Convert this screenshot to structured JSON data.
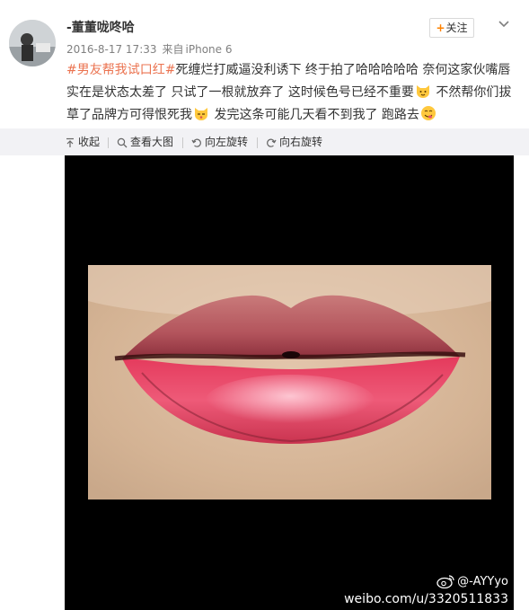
{
  "post": {
    "username": "-董董咙咚哈",
    "timestamp": "2016-8-17 17:33",
    "source_prefix": "来自",
    "source": "iPhone 6",
    "follow_label": "关注",
    "text": {
      "topic": "#男友帮我试口红#",
      "seg1": "死缠烂打威逼没利诱下 终于拍了哈哈哈哈哈 奈何这家伙嘴唇实在是状态太差了 只试了一根就放弃了 这时候色号已经不重要",
      "seg2": " 不然帮你们拔草了品牌方可得恨死我",
      "seg3": " 发完这条可能几天看不到我了 跑路去",
      "emojis": [
        "cat-emoji",
        "cat-emoji",
        "yum-emoji"
      ]
    }
  },
  "toolbar": {
    "collapse": "收起",
    "view_large": "查看大图",
    "rotate_left": "向左旋转",
    "rotate_right": "向右旋转"
  },
  "image": {
    "subject": "lips",
    "watermark_handle": "@-AYYyo",
    "watermark_url": "weibo.com/u/3320511833"
  },
  "colors": {
    "topic": "#eb7350",
    "follow_plus": "#ff8200",
    "toolbar_bg": "#f2f2f5",
    "meta": "#808080",
    "lipstick": "#e8446a"
  }
}
